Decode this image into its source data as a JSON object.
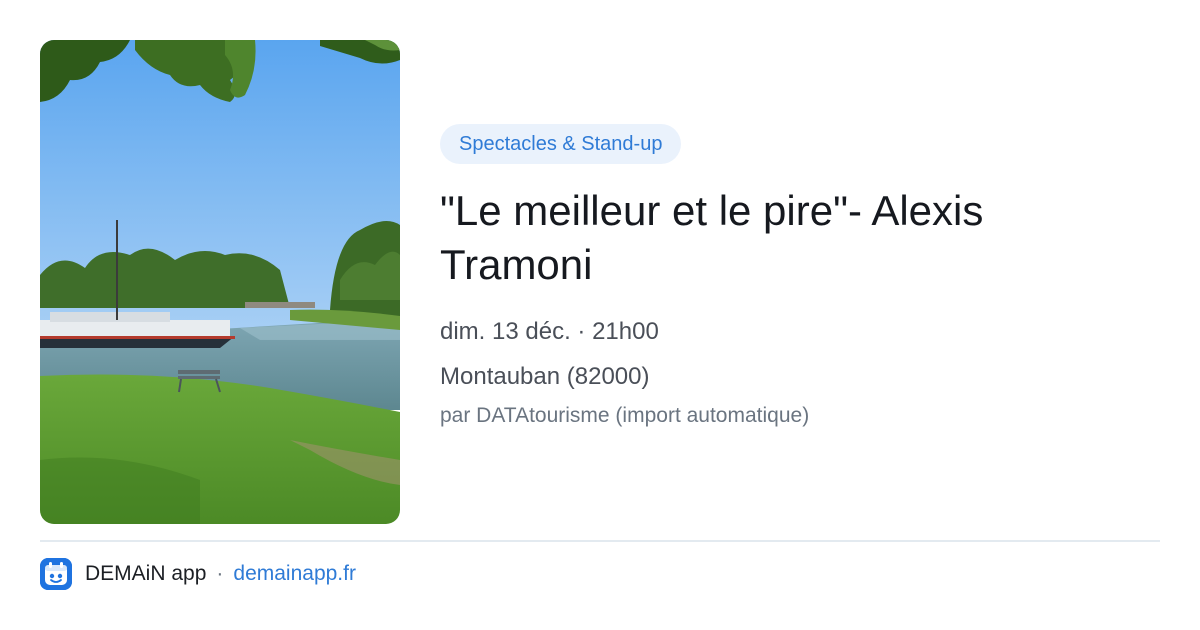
{
  "event": {
    "category": "Spectacles & Stand-up",
    "title": "\"Le meilleur et le pire\"- Alexis Tramoni",
    "date": "dim. 13 déc. · 21h00",
    "location": "Montauban (82000)",
    "source": "par DATAtourisme (import automatique)"
  },
  "footer": {
    "app_name": "DEMAiN app",
    "separator": "·",
    "link": "demainapp.fr"
  },
  "colors": {
    "accent": "#2f7bd6",
    "category_bg": "#eaf2fc",
    "app_logo": "#1f73e0"
  },
  "icons": {
    "app_logo": "demain-app-logo-icon"
  }
}
